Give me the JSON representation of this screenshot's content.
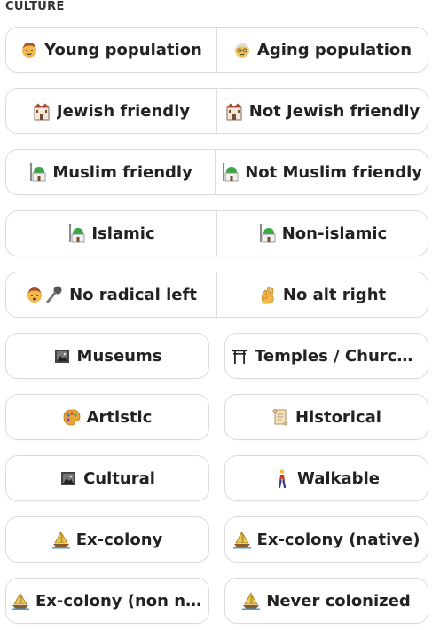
{
  "section": {
    "title": "CULTURE"
  },
  "buttons": {
    "young": "Young population",
    "aging": "Aging population",
    "jewish": "Jewish friendly",
    "not_jewish": "Not Jewish friendly",
    "muslim": "Muslim friendly",
    "not_muslim": "Not Muslim friendly",
    "islamic": "Islamic",
    "non_islamic": "Non-islamic",
    "no_radical_left": "No radical left",
    "no_alt_right": "No alt right",
    "museums": "Museums",
    "temples": "Temples / Churches",
    "artistic": "Artistic",
    "historical": "Historical",
    "cultural": "Cultural",
    "walkable": "Walkable",
    "ex_colony": "Ex-colony",
    "ex_colony_native": "Ex-colony (native)",
    "ex_colony_non_native": "Ex-colony (non n...",
    "never_colonized": "Never colonized"
  },
  "icons": {
    "young": "boy-face-icon",
    "aging": "older-person-face-icon",
    "synagogue": "synagogue-icon",
    "mosque": "mosque-icon",
    "singer": "singer-icon",
    "ok_hand": "ok-hand-icon",
    "frame": "framed-picture-icon",
    "shinto_shrine": "shinto-shrine-icon",
    "palette": "artist-palette-icon",
    "scroll": "scroll-icon",
    "walking": "person-walking-icon",
    "sailboat": "sailboat-icon"
  },
  "colors": {
    "border": "#dcdcdc",
    "text": "#222222",
    "background": "#ffffff"
  }
}
